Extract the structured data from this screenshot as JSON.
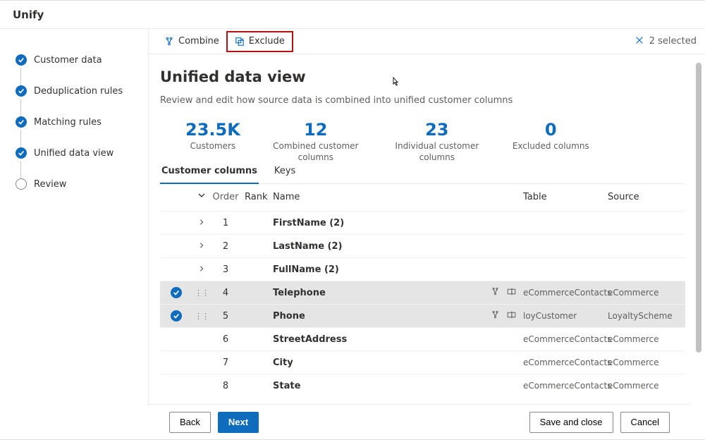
{
  "header": {
    "title": "Unify"
  },
  "sidebar": {
    "steps": [
      {
        "label": "Customer data",
        "done": true
      },
      {
        "label": "Deduplication rules",
        "done": true
      },
      {
        "label": "Matching rules",
        "done": true
      },
      {
        "label": "Unified data view",
        "done": true
      },
      {
        "label": "Review",
        "done": false
      }
    ]
  },
  "toolbar": {
    "combine_label": "Combine",
    "exclude_label": "Exclude",
    "selected_label": "2 selected"
  },
  "page": {
    "title": "Unified data view",
    "desc": "Review and edit how source data is combined into unified customer columns"
  },
  "stats": [
    {
      "val": "23.5K",
      "label": "Customers"
    },
    {
      "val": "12",
      "label": "Combined customer columns"
    },
    {
      "val": "23",
      "label": "Individual customer columns"
    },
    {
      "val": "0",
      "label": "Excluded columns"
    }
  ],
  "tabs": {
    "customer_columns": "Customer columns",
    "keys": "Keys"
  },
  "columns": {
    "order": "Order",
    "rank": "Rank",
    "name": "Name",
    "table": "Table",
    "source": "Source"
  },
  "rows": [
    {
      "expandable": true,
      "order": "1",
      "name": "FirstName (2)",
      "table": "",
      "source": "",
      "selected": false,
      "showIcons": false
    },
    {
      "expandable": true,
      "order": "2",
      "name": "LastName (2)",
      "table": "",
      "source": "",
      "selected": false,
      "showIcons": false
    },
    {
      "expandable": true,
      "order": "3",
      "name": "FullName (2)",
      "table": "",
      "source": "",
      "selected": false,
      "showIcons": false
    },
    {
      "expandable": false,
      "order": "4",
      "name": "Telephone",
      "table": "eCommerceContacts",
      "source": "eCommerce",
      "selected": true,
      "showIcons": true
    },
    {
      "expandable": false,
      "order": "5",
      "name": "Phone",
      "table": "loyCustomer",
      "source": "LoyaltyScheme",
      "selected": true,
      "showIcons": true
    },
    {
      "expandable": false,
      "order": "6",
      "name": "StreetAddress",
      "table": "eCommerceContacts",
      "source": "eCommerce",
      "selected": false,
      "showIcons": false
    },
    {
      "expandable": false,
      "order": "7",
      "name": "City",
      "table": "eCommerceContacts",
      "source": "eCommerce",
      "selected": false,
      "showIcons": false
    },
    {
      "expandable": false,
      "order": "8",
      "name": "State",
      "table": "eCommerceContacts",
      "source": "eCommerce",
      "selected": false,
      "showIcons": false
    }
  ],
  "footer": {
    "back": "Back",
    "next": "Next",
    "save_close": "Save and close",
    "cancel": "Cancel"
  }
}
